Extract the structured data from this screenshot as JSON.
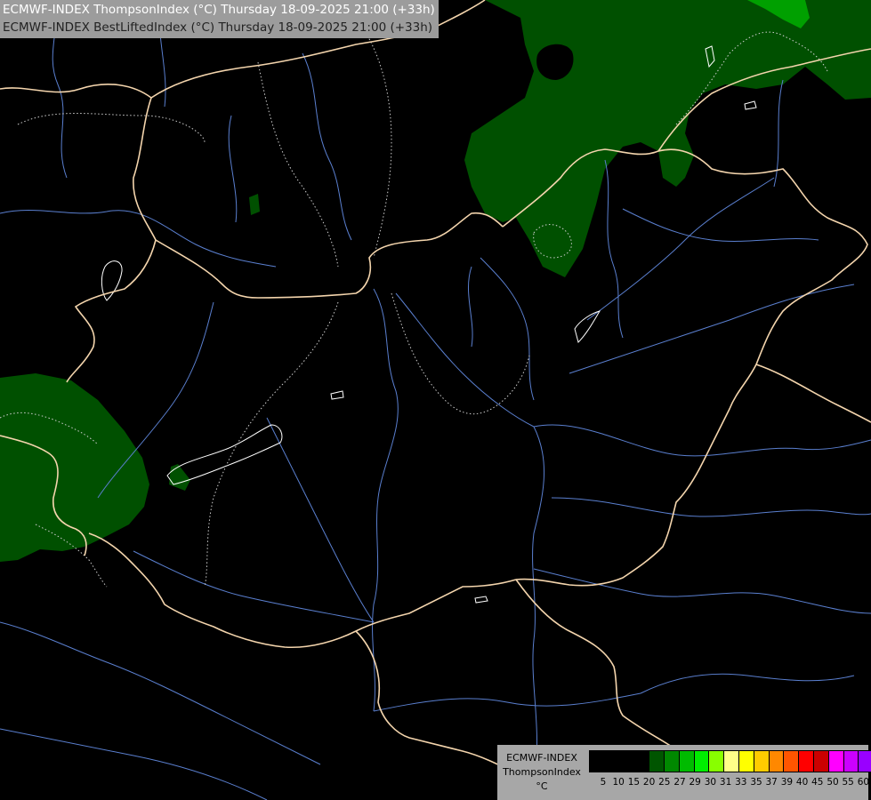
{
  "titles": {
    "line1": "ECMWF-INDEX ThompsonIndex (°C) Thursday 18-09-2025 21:00 (+33h)",
    "line2": "ECMWF-INDEX BestLiftedIndex (°C) Thursday 18-09-2025 21:00 (+33h)"
  },
  "legend": {
    "model": "ECMWF-INDEX",
    "parameter": "ThompsonIndex",
    "unit": "°C",
    "ticks": [
      "5",
      "10",
      "15",
      "20",
      "25",
      "27",
      "29",
      "30",
      "31",
      "33",
      "35",
      "37",
      "39",
      "40",
      "45",
      "50",
      "55",
      "60"
    ],
    "colors": [
      "#000000",
      "#000000",
      "#000000",
      "#000000",
      "#005500",
      "#008800",
      "#00bb00",
      "#00ee00",
      "#88ff00",
      "#ffff88",
      "#ffff00",
      "#ffcc00",
      "#ff8800",
      "#ff5500",
      "#ff0000",
      "#cc0000",
      "#ff00ff",
      "#cc00ff",
      "#9900ff",
      "#6600ff",
      "#0000ff"
    ]
  },
  "map": {
    "colors": {
      "background": "#000000",
      "shading": "#005000",
      "shading_bright": "#00a000",
      "border": "#f4d5ad",
      "river": "#5a7fcf",
      "lake": "#ffffff",
      "isoline": "#cfcfcf"
    }
  }
}
